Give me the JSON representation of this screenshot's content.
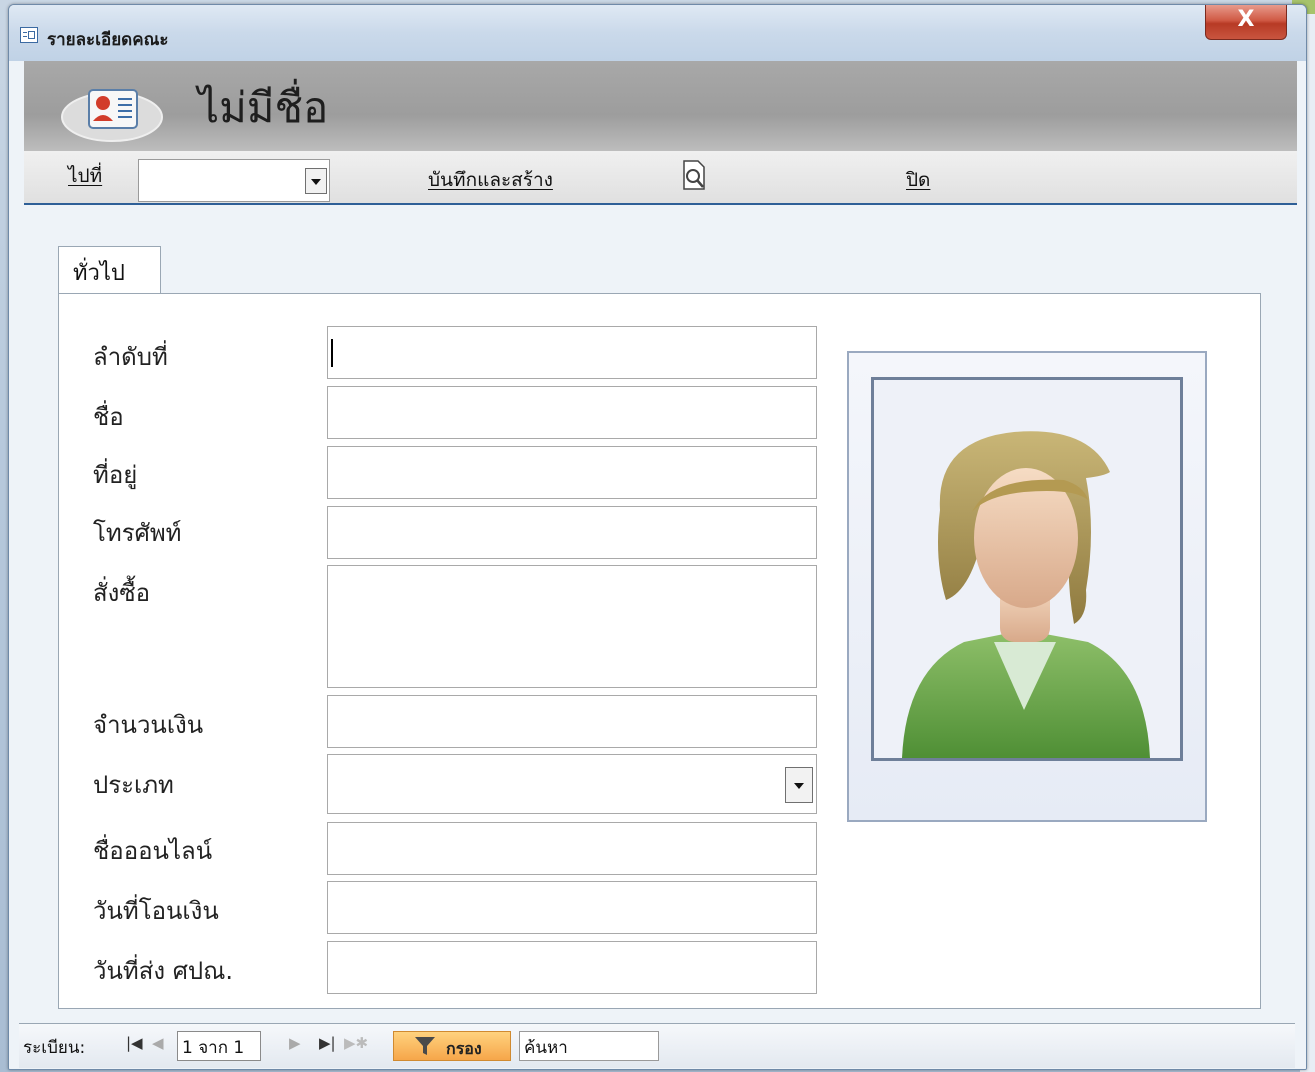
{
  "window": {
    "title": "รายละเอียดคณะ",
    "close_label": "X"
  },
  "header": {
    "title": "ไม่มีชื่อ",
    "icon": "contact-card-icon"
  },
  "toolbar": {
    "goto_label": "ไปที่",
    "goto_value": "",
    "save_new_label": "บันทึกและสร้าง",
    "find_icon": "magnifier-page-icon",
    "close_label": "ปิด"
  },
  "tabs": [
    {
      "label": "ทั่วไป",
      "active": true
    }
  ],
  "form": {
    "fields": [
      {
        "label": "ลำดับที่",
        "value": ""
      },
      {
        "label": "ชื่อ",
        "value": ""
      },
      {
        "label": "ที่อยู่",
        "value": ""
      },
      {
        "label": "โทรศัพท์",
        "value": ""
      },
      {
        "label": "สั่งซื้อ",
        "value": ""
      },
      {
        "label": "จำนวนเงิน",
        "value": ""
      },
      {
        "label": "ประเภท",
        "value": ""
      },
      {
        "label": "ชื่อออนไลน์",
        "value": ""
      },
      {
        "label": "วันที่โอนเงิน",
        "value": ""
      },
      {
        "label": "วันที่ส่ง ศปณ.",
        "value": ""
      }
    ],
    "photo": {
      "icon": "person-placeholder-icon"
    }
  },
  "record_nav": {
    "label": "ระเบียน:",
    "position": "1 จาก 1",
    "filter_label": "กรอง",
    "search_value": "ค้นหา"
  },
  "colors": {
    "toolbar_rule": "#2e5f97",
    "header_band": "#a8a8a8",
    "filter_button": "#f6a64a",
    "close_button": "#c9553f"
  }
}
